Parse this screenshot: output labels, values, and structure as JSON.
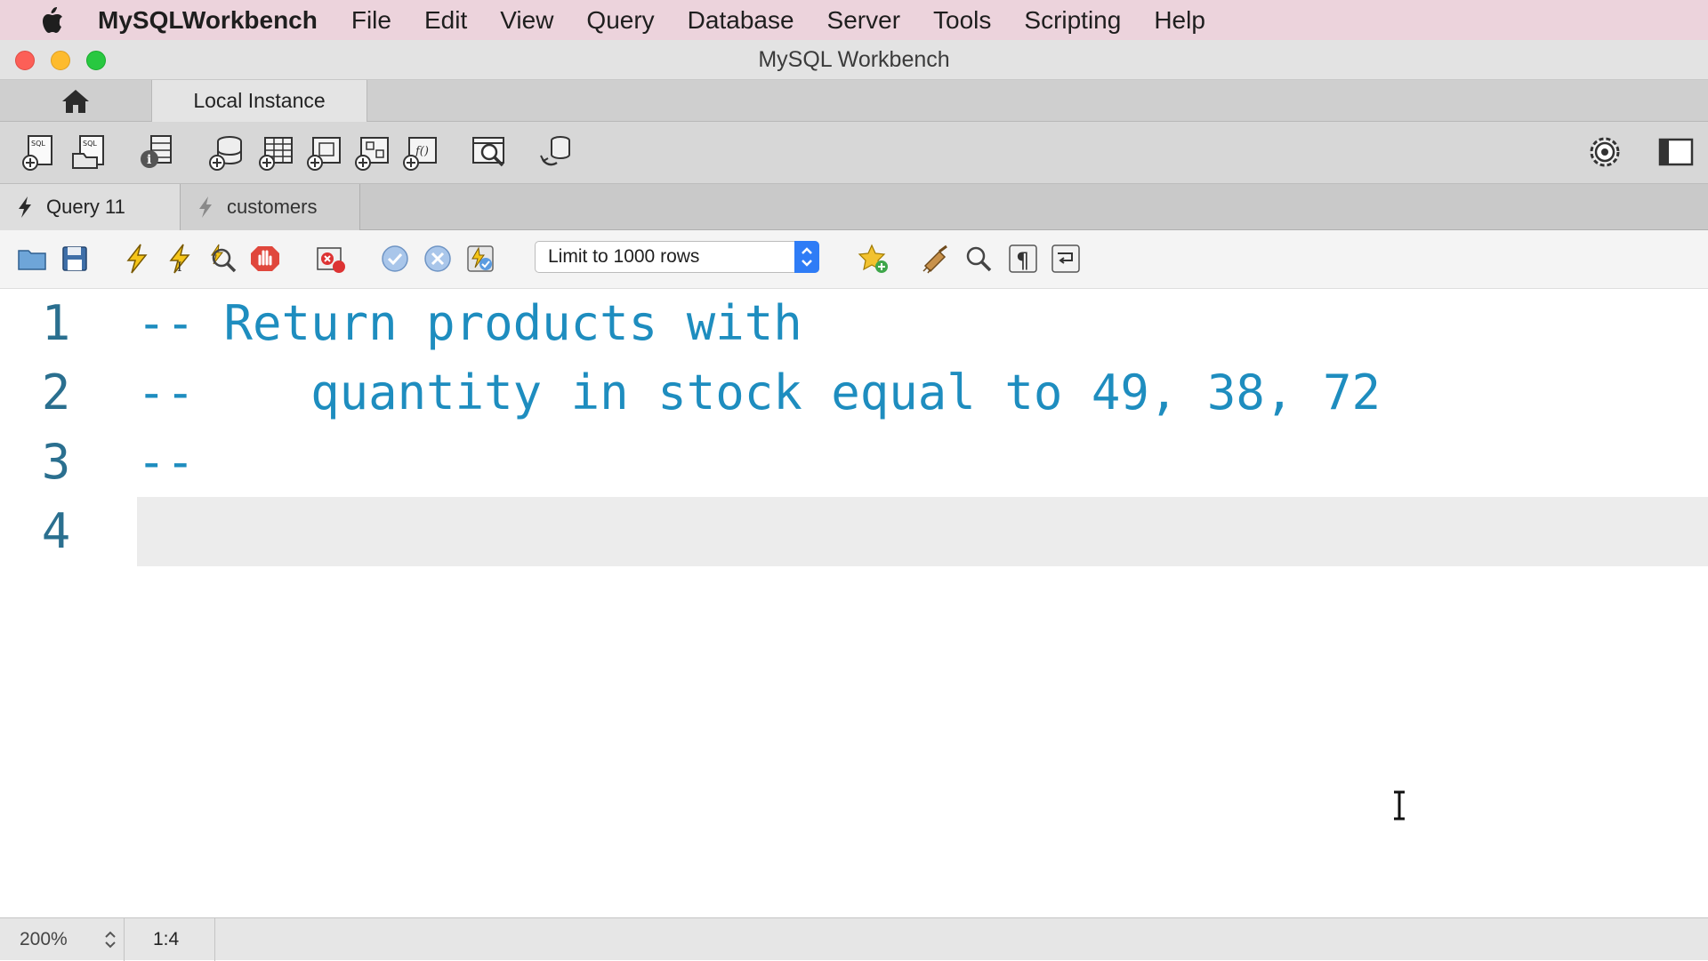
{
  "menubar": {
    "app_name": "MySQLWorkbench",
    "items": [
      "File",
      "Edit",
      "View",
      "Query",
      "Database",
      "Server",
      "Tools",
      "Scripting",
      "Help"
    ]
  },
  "window": {
    "title": "MySQL Workbench"
  },
  "connection_tabs": {
    "local_instance": "Local Instance"
  },
  "query_tabs": [
    {
      "label": "Query 11",
      "active": true
    },
    {
      "label": "customers",
      "active": false
    }
  ],
  "editor_toolbar": {
    "limit_rows": "Limit to 1000 rows"
  },
  "editor": {
    "lines": [
      {
        "number": "1",
        "text": "-- Return products with"
      },
      {
        "number": "2",
        "text": "--    quantity in stock equal to 49, 38, 72"
      },
      {
        "number": "3",
        "text": "--"
      },
      {
        "number": "4",
        "text": ""
      }
    ],
    "current_line": 4
  },
  "statusbar": {
    "zoom": "200%",
    "cursor_position": "1:4"
  },
  "colors": {
    "menubar_bg": "#ecd3dc",
    "comment_text": "#1e8dbf",
    "line_number": "#2a6f8f",
    "select_stepper": "#2e7cf6"
  }
}
